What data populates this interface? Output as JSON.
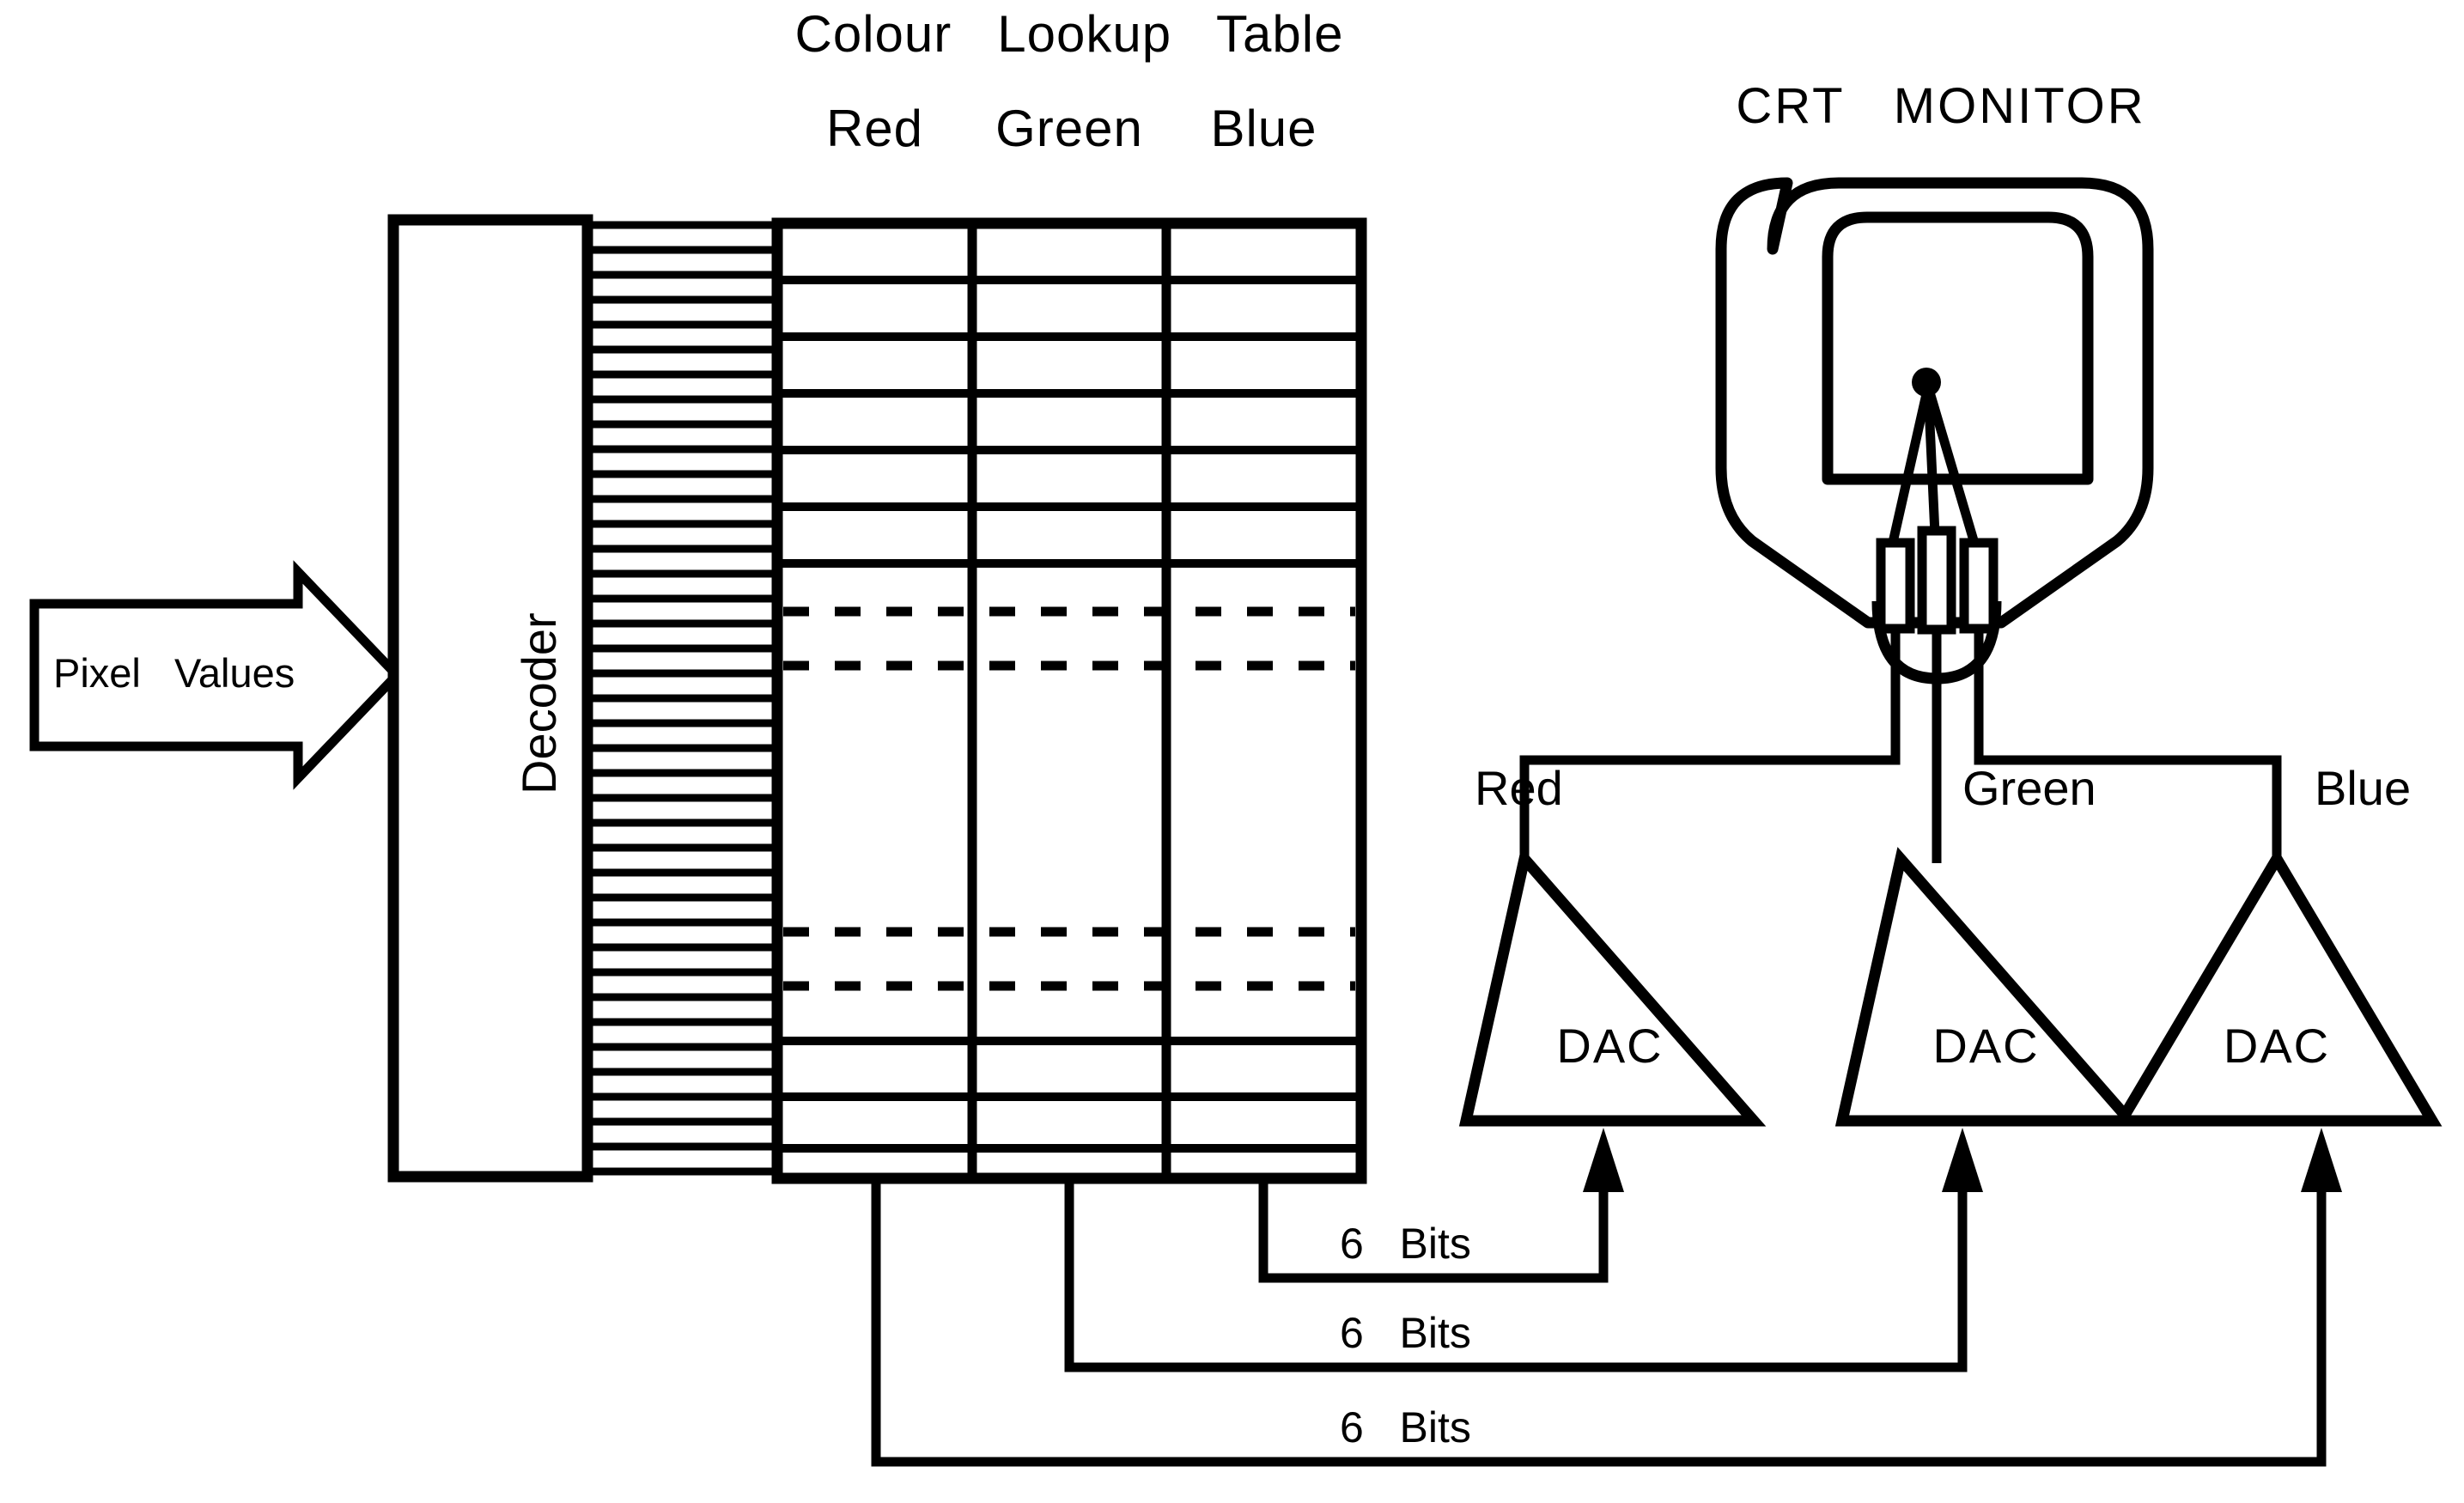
{
  "diagram": {
    "title": "Colour Lookup Table architecture with CRT monitor",
    "ink_color": "#000000",
    "background_color": "#ffffff"
  },
  "lookup_table": {
    "title": "Colour   Lookup   Table",
    "columns": [
      {
        "label": "Red"
      },
      {
        "label": "Green"
      },
      {
        "label": "Blue"
      }
    ],
    "row_count_top": 6,
    "row_count_mid": 4,
    "row_count_bottom": 3,
    "ellipsis_marker": "dashed"
  },
  "decoder": {
    "label": "Decoder",
    "address_line_count": 38
  },
  "input": {
    "label": "Pixel   Values"
  },
  "monitor": {
    "title": "CRT   MONITOR",
    "gun_count": 3,
    "beam_labels": [
      {
        "label": "Red"
      },
      {
        "label": "Green"
      },
      {
        "label": "Blue"
      }
    ]
  },
  "converters": [
    {
      "label": "DAC",
      "channel": "Blue"
    },
    {
      "label": "DAC",
      "channel": "Green"
    },
    {
      "label": "DAC",
      "channel": "Red"
    }
  ],
  "buses": [
    {
      "label": "6   Bits",
      "source_column": "Blue"
    },
    {
      "label": "6   Bits",
      "source_column": "Green"
    },
    {
      "label": "6   Bits",
      "source_column": "Red"
    }
  ]
}
